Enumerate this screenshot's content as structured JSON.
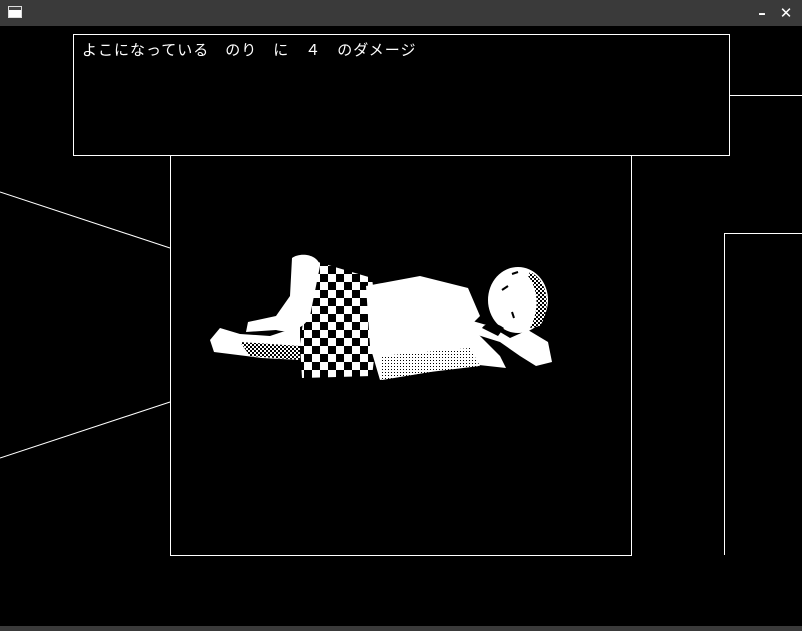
{
  "window": {
    "icon": "app-window-icon",
    "minimize_label": "–",
    "close_label": "✕"
  },
  "message": {
    "text": "よこになっている　のり　に　４　のダメージ"
  },
  "scene": {
    "figure": "lying-child-figure"
  }
}
